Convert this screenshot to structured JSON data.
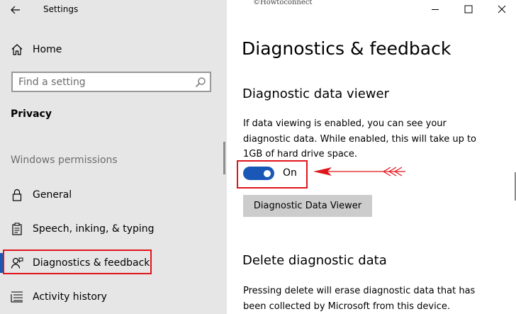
{
  "window": {
    "app_title": "Settings",
    "watermark": "©Howtoconnect"
  },
  "sidebar": {
    "home_label": "Home",
    "search_placeholder": "Find a setting",
    "section_title": "Privacy",
    "group_label": "Windows permissions",
    "items": [
      {
        "label": "General",
        "icon": "lock-icon"
      },
      {
        "label": "Speech, inking, & typing",
        "icon": "clipboard-icon"
      },
      {
        "label": "Diagnostics & feedback",
        "icon": "feedback-icon",
        "selected": true
      },
      {
        "label": "Activity history",
        "icon": "activity-list-icon"
      }
    ]
  },
  "main": {
    "page_title": "Diagnostics & feedback",
    "viewer_section": {
      "heading": "Diagnostic data viewer",
      "description": "If data viewing is enabled, you can see your diagnostic data. While enabled, this will take up to 1GB of hard drive space.",
      "toggle_state": "On",
      "toggle_on": true,
      "button_label": "Diagnostic Data Viewer"
    },
    "delete_section": {
      "heading": "Delete diagnostic data",
      "description": "Pressing delete will erase diagnostic data that has been collected by Microsoft from this device."
    }
  },
  "colors": {
    "accent": "#1a58b8",
    "highlight": "#e0151b",
    "sidebar_bg": "#e6e6e6",
    "button_bg": "#cccccc"
  }
}
